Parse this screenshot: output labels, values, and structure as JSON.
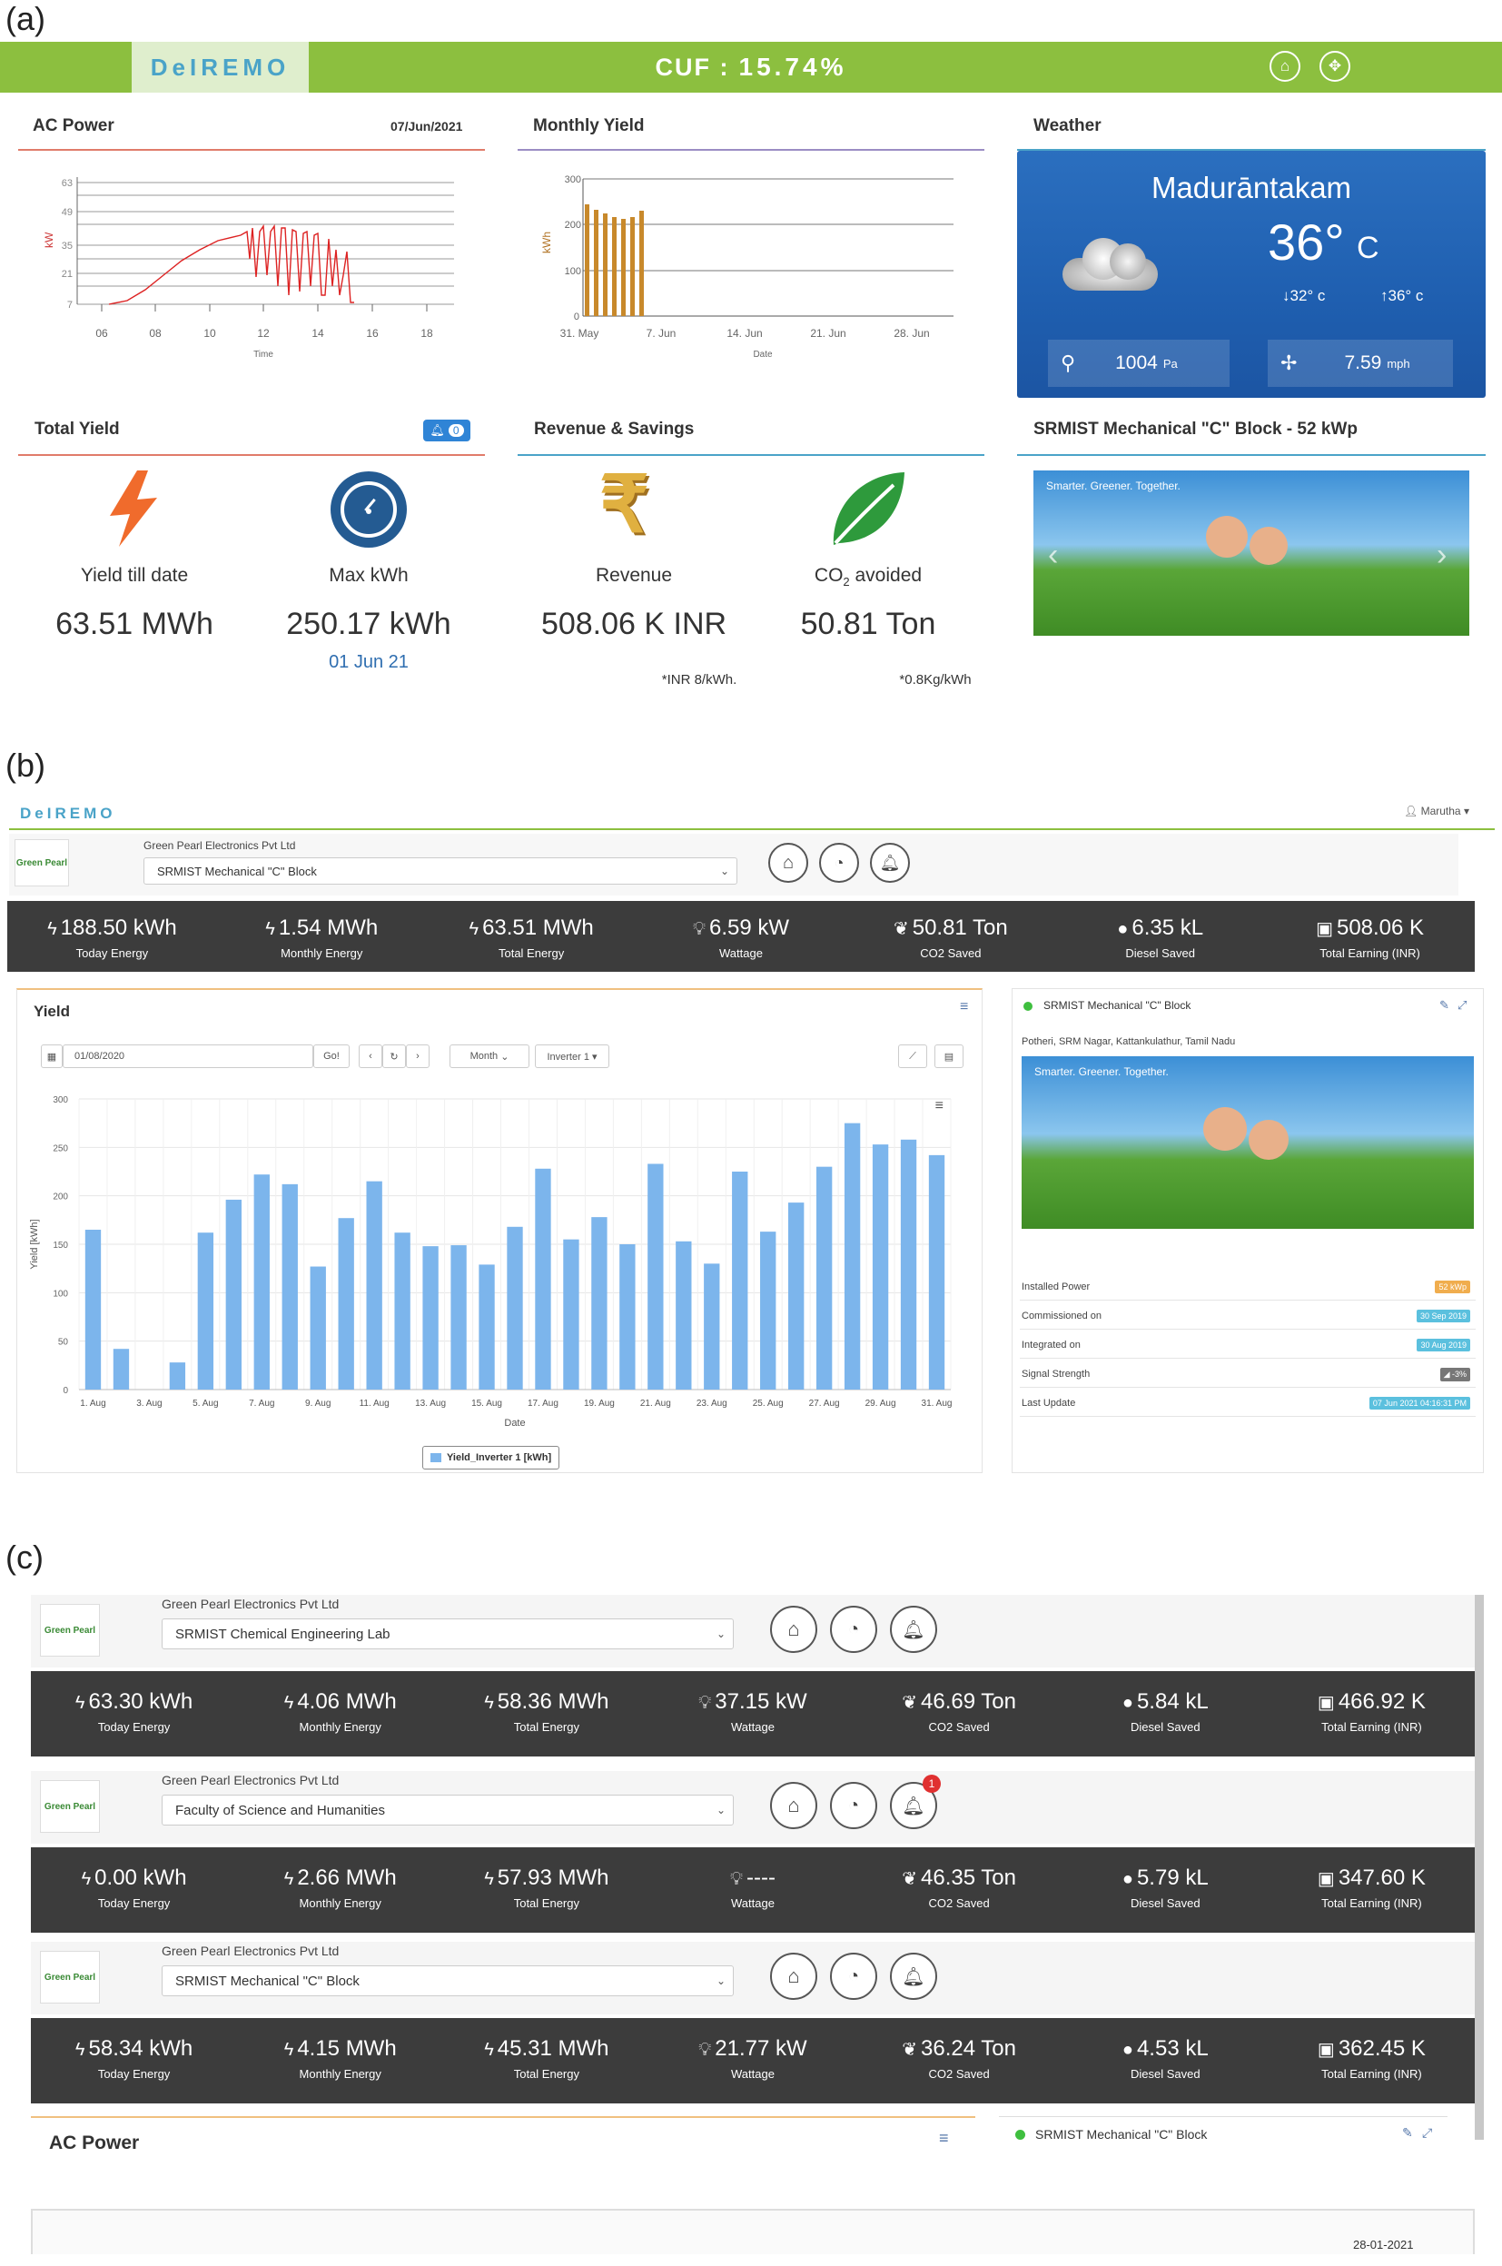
{
  "panel_labels": {
    "a": "(a)",
    "b": "(b)",
    "c": "(c)"
  },
  "a": {
    "brand": "DeIREMO",
    "cuf_label": "CUF :",
    "cuf_value": "15.74%",
    "ac_power": {
      "title": "AC Power",
      "date": "07/Jun/2021",
      "ylabel": "kW",
      "xlabel": "Time",
      "yticks": [
        "63",
        "49",
        "35",
        "21",
        "7"
      ],
      "xticks": [
        "06",
        "08",
        "10",
        "12",
        "14",
        "16",
        "18"
      ]
    },
    "monthly_yield": {
      "title": "Monthly Yield",
      "ylabel": "kWh",
      "xlabel": "Date",
      "yticks": [
        "300",
        "200",
        "100",
        "0"
      ],
      "xticks": [
        "31. May",
        "7. Jun",
        "14. Jun",
        "21. Jun",
        "28. Jun"
      ]
    },
    "weather": {
      "title": "Weather",
      "city": "Madurāntakam",
      "temp": "36°",
      "unit": "C",
      "min": "↓32° c",
      "max": "↑36° c",
      "pressure": "1004",
      "pressure_unit": "Pa",
      "wind": "7.59",
      "wind_unit": "mph"
    },
    "total_yield": {
      "title": "Total Yield",
      "badge": "0",
      "yield_label": "Yield till date",
      "yield_value": "63.51 MWh",
      "max_label": "Max kWh",
      "max_value": "250.17 kWh",
      "max_date": "01 Jun 21"
    },
    "revenue": {
      "title": "Revenue & Savings",
      "rev_label": "Revenue",
      "rev_value": "508.06 K INR",
      "rev_note": "*INR 8/kWh.",
      "co2_label_main": "CO",
      "co2_label_sub": "2",
      "co2_label_rest": " avoided",
      "co2_value": "50.81 Ton",
      "co2_note": "*0.8Kg/kWh"
    },
    "site": {
      "title": "SRMIST Mechanical \"C\" Block - 52 kWp",
      "banner_tag": "Smarter. Greener. Together."
    }
  },
  "b": {
    "brand": "DeIREMO",
    "user": "Marutha",
    "company": "Green Pearl Electronics Pvt Ltd",
    "logo_text": "Green Pearl",
    "site_select": "SRMIST Mechanical \"C\" Block",
    "stats": [
      {
        "value": "188.50 kWh",
        "label": "Today Energy",
        "icon": "bolt-icon"
      },
      {
        "value": "1.54 MWh",
        "label": "Monthly Energy",
        "icon": "bolt-icon"
      },
      {
        "value": "63.51 MWh",
        "label": "Total Energy",
        "icon": "bolt-icon"
      },
      {
        "value": "6.59 kW",
        "label": "Wattage",
        "icon": "bulb-icon"
      },
      {
        "value": "50.81 Ton",
        "label": "CO2 Saved",
        "icon": "leaf-icon"
      },
      {
        "value": "6.35 kL",
        "label": "Diesel Saved",
        "icon": "drop-icon"
      },
      {
        "value": "508.06 K",
        "label": "Total Earning (INR)",
        "icon": "money-icon"
      }
    ],
    "yield_panel": {
      "title": "Yield",
      "date": "01/08/2020",
      "go": "Go!",
      "period": "Month",
      "inverter": "Inverter 1 ▾",
      "legend": "Yield_Inverter 1 [kWh]"
    },
    "site_panel": {
      "name": "SRMIST Mechanical \"C\" Block",
      "address": "Potheri, SRM Nagar, Kattankulathur, Tamil Nadu",
      "banner_tag": "Smarter. Greener. Together.",
      "rows": [
        {
          "label": "Installed Power",
          "value": "52 kWp",
          "color": "#f0ad4e"
        },
        {
          "label": "Commissioned on",
          "value": "30 Sep 2019",
          "color": "#5bc0de"
        },
        {
          "label": "Integrated on",
          "value": "30 Aug 2019",
          "color": "#5bc0de"
        },
        {
          "label": "Signal Strength",
          "value": "◢ -3%",
          "color": "#777777"
        },
        {
          "label": "Last Update",
          "value": "07 Jun 2021 04:16:31 PM",
          "color": "#5bc0de"
        }
      ]
    }
  },
  "chart_data": {
    "type": "bar",
    "title": "",
    "xlabel": "Date",
    "ylabel": "Yield [kWh]",
    "ylim": [
      0,
      300
    ],
    "yticks": [
      0,
      50,
      100,
      150,
      200,
      250,
      300
    ],
    "xticks": [
      "1. Aug",
      "3. Aug",
      "5. Aug",
      "7. Aug",
      "9. Aug",
      "11. Aug",
      "13. Aug",
      "15. Aug",
      "17. Aug",
      "19. Aug",
      "21. Aug",
      "23. Aug",
      "25. Aug",
      "27. Aug",
      "29. Aug",
      "31. Aug"
    ],
    "categories": [
      "1. Aug",
      "2. Aug",
      "3. Aug",
      "4. Aug",
      "5. Aug",
      "6. Aug",
      "7. Aug",
      "8. Aug",
      "9. Aug",
      "10. Aug",
      "11. Aug",
      "12. Aug",
      "13. Aug",
      "14. Aug",
      "15. Aug",
      "16. Aug",
      "17. Aug",
      "18. Aug",
      "19. Aug",
      "20. Aug",
      "21. Aug",
      "22. Aug",
      "23. Aug",
      "24. Aug",
      "25. Aug",
      "26. Aug",
      "27. Aug",
      "28. Aug",
      "29. Aug",
      "30. Aug",
      "31. Aug"
    ],
    "series": [
      {
        "name": "Yield_Inverter 1 [kWh]",
        "values": [
          165,
          42,
          0,
          28,
          162,
          196,
          222,
          212,
          127,
          177,
          215,
          162,
          148,
          149,
          129,
          168,
          228,
          155,
          178,
          150,
          233,
          153,
          130,
          225,
          163,
          193,
          230,
          275,
          253,
          258,
          242
        ]
      }
    ],
    "color": "#7cb5ec",
    "grid": true,
    "legend": "bottom-center"
  },
  "c": {
    "blocks": [
      {
        "company": "Green Pearl Electronics Pvt Ltd",
        "logo_text": "Green Pearl",
        "site": "SRMIST Chemical Engineering Lab",
        "alert": "",
        "stats": [
          {
            "value": "63.30 kWh",
            "label": "Today Energy",
            "icon": "bolt-icon"
          },
          {
            "value": "4.06 MWh",
            "label": "Monthly Energy",
            "icon": "bolt-icon"
          },
          {
            "value": "58.36 MWh",
            "label": "Total Energy",
            "icon": "bolt-icon"
          },
          {
            "value": "37.15 kW",
            "label": "Wattage",
            "icon": "bulb-icon"
          },
          {
            "value": "46.69 Ton",
            "label": "CO2 Saved",
            "icon": "leaf-icon"
          },
          {
            "value": "5.84 kL",
            "label": "Diesel Saved",
            "icon": "drop-icon"
          },
          {
            "value": "466.92 K",
            "label": "Total Earning (INR)",
            "icon": "money-icon"
          }
        ]
      },
      {
        "company": "Green Pearl Electronics Pvt Ltd",
        "logo_text": "Green Pearl",
        "site": "Faculty of Science and Humanities",
        "alert": "1",
        "stats": [
          {
            "value": "0.00 kWh",
            "label": "Today Energy",
            "icon": "bolt-icon"
          },
          {
            "value": "2.66 MWh",
            "label": "Monthly Energy",
            "icon": "bolt-icon"
          },
          {
            "value": "57.93 MWh",
            "label": "Total Energy",
            "icon": "bolt-icon"
          },
          {
            "value": "----",
            "label": "Wattage",
            "icon": "bulb-icon"
          },
          {
            "value": "46.35 Ton",
            "label": "CO2 Saved",
            "icon": "leaf-icon"
          },
          {
            "value": "5.79 kL",
            "label": "Diesel Saved",
            "icon": "drop-icon"
          },
          {
            "value": "347.60 K",
            "label": "Total Earning (INR)",
            "icon": "money-icon"
          }
        ]
      },
      {
        "company": "Green Pearl Electronics Pvt Ltd",
        "logo_text": "Green Pearl",
        "site": "SRMIST Mechanical \"C\" Block",
        "alert": "",
        "stats": [
          {
            "value": "58.34 kWh",
            "label": "Today Energy",
            "icon": "bolt-icon"
          },
          {
            "value": "4.15 MWh",
            "label": "Monthly Energy",
            "icon": "bolt-icon"
          },
          {
            "value": "45.31 MWh",
            "label": "Total Energy",
            "icon": "bolt-icon"
          },
          {
            "value": "21.77 kW",
            "label": "Wattage",
            "icon": "bulb-icon"
          },
          {
            "value": "36.24 Ton",
            "label": "CO2 Saved",
            "icon": "leaf-icon"
          },
          {
            "value": "4.53 kL",
            "label": "Diesel Saved",
            "icon": "drop-icon"
          },
          {
            "value": "362.45 K",
            "label": "Total Earning (INR)",
            "icon": "money-icon"
          }
        ]
      }
    ],
    "ac_power_title": "AC Power",
    "site_name": "SRMIST Mechanical \"C\" Block",
    "footer_date": "28-01-2021"
  }
}
